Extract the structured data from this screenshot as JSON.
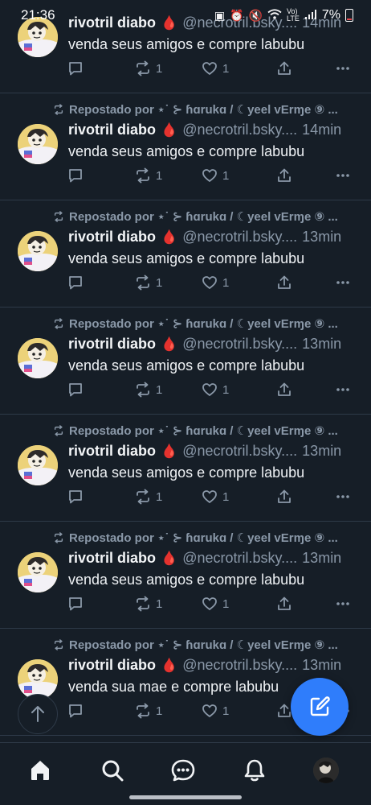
{
  "status_bar": {
    "time": "21:36",
    "icons": [
      "sd-card-icon",
      "alarm-icon",
      "mute-icon",
      "wifi-icon",
      "volte-icon",
      "signal-icon"
    ],
    "battery": "7%"
  },
  "posts": [
    {
      "reposted_by": "",
      "author": "rivotril diabo",
      "handle": "@necrotril.bsky....",
      "time": "14min",
      "text": "venda seus amigos e compre labubu",
      "replies": "",
      "reposts": "1",
      "likes": "1"
    },
    {
      "reposted_by": "Repostado por ⋆˙ ⊱ ɦɑrukɑ / ☾yeel vErɱe ⑨ ...",
      "author": "rivotril diabo",
      "handle": "@necrotril.bsky....",
      "time": "14min",
      "text": "venda seus amigos e compre labubu",
      "replies": "",
      "reposts": "1",
      "likes": "1"
    },
    {
      "reposted_by": "Repostado por ⋆˙ ⊱ ɦɑrukɑ / ☾yeel vErɱe ⑨ ...",
      "author": "rivotril diabo",
      "handle": "@necrotril.bsky....",
      "time": "13min",
      "text": "venda seus amigos e compre labubu",
      "replies": "",
      "reposts": "1",
      "likes": "1"
    },
    {
      "reposted_by": "Repostado por ⋆˙ ⊱ ɦɑrukɑ / ☾yeel vErɱe ⑨ ...",
      "author": "rivotril diabo",
      "handle": "@necrotril.bsky....",
      "time": "13min",
      "text": "venda seus amigos e compre labubu",
      "replies": "",
      "reposts": "1",
      "likes": "1"
    },
    {
      "reposted_by": "Repostado por ⋆˙ ⊱ ɦɑrukɑ / ☾yeel vErɱe ⑨ ...",
      "author": "rivotril diabo",
      "handle": "@necrotril.bsky....",
      "time": "13min",
      "text": "venda seus amigos e compre labubu",
      "replies": "",
      "reposts": "1",
      "likes": "1"
    },
    {
      "reposted_by": "Repostado por ⋆˙ ⊱ ɦɑrukɑ / ☾yeel vErɱe ⑨ ...",
      "author": "rivotril diabo",
      "handle": "@necrotril.bsky....",
      "time": "13min",
      "text": "venda seus amigos e compre labubu",
      "replies": "",
      "reposts": "1",
      "likes": "1"
    },
    {
      "reposted_by": "Repostado por ⋆˙ ⊱ ɦɑrukɑ / ☾yeel vErɱe ⑨ ...",
      "author": "rivotril diabo",
      "handle": "@necrotril.bsky....",
      "time": "13min",
      "text": "venda sua mae e compre labubu",
      "replies": "",
      "reposts": "1",
      "likes": "1"
    }
  ],
  "nav": {
    "items": [
      "home-icon",
      "search-icon",
      "chat-icon",
      "bell-icon",
      "profile-avatar"
    ]
  },
  "colors": {
    "background": "#161e27",
    "muted_text": "#8a98a8",
    "accent": "#2f7dfb",
    "drop": "#d1142b"
  }
}
